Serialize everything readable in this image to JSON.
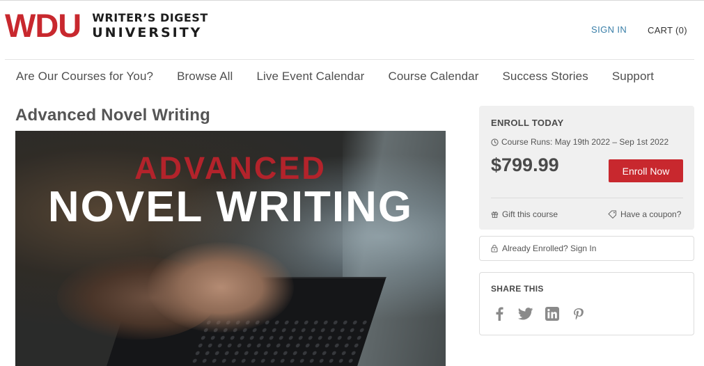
{
  "header": {
    "logo_mark": "WDU",
    "logo_line1": "WRITER’S DIGEST",
    "logo_line2": "UNIVERSITY",
    "sign_in": "SIGN IN",
    "cart": "CART (0)"
  },
  "nav": {
    "items": [
      {
        "label": "Are Our Courses for You?"
      },
      {
        "label": "Browse All"
      },
      {
        "label": "Live Event Calendar"
      },
      {
        "label": "Course Calendar"
      },
      {
        "label": "Success Stories"
      },
      {
        "label": "Support"
      }
    ]
  },
  "main": {
    "title": "Advanced Novel Writing",
    "hero": {
      "line1": "ADVANCED",
      "line2": "NOVEL WRITING"
    }
  },
  "sidebar": {
    "enroll_heading": "ENROLL TODAY",
    "course_runs": "Course Runs: May 19th 2022 – Sep 1st 2022",
    "price": "$799.99",
    "enroll_button": "Enroll Now",
    "gift": "Gift this course",
    "coupon": "Have a coupon?",
    "already_enrolled": "Already Enrolled? Sign In",
    "share_heading": "SHARE THIS",
    "share_icons": [
      "facebook-icon",
      "twitter-icon",
      "linkedin-icon",
      "pinterest-icon"
    ]
  },
  "colors": {
    "brand_red": "#c8282e",
    "link_blue": "#3a7fa8",
    "card_bg": "#f0f0f0"
  }
}
